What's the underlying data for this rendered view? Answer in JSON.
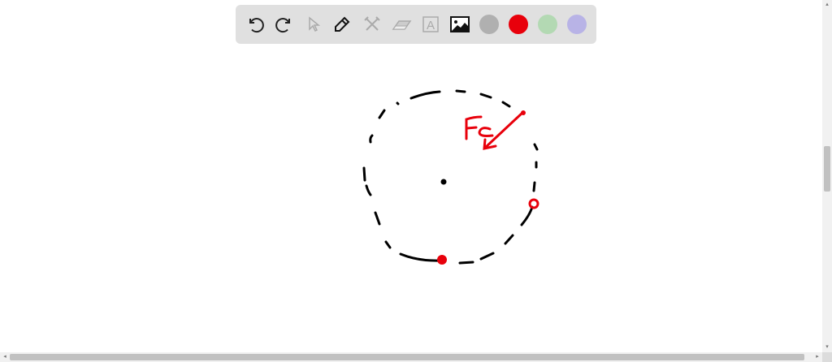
{
  "toolbar": {
    "tools": [
      {
        "name": "undo",
        "icon": "undo-icon",
        "enabled": true
      },
      {
        "name": "redo",
        "icon": "redo-icon",
        "enabled": true
      },
      {
        "name": "select",
        "icon": "cursor-icon",
        "enabled": false
      },
      {
        "name": "pen",
        "icon": "pencil-icon",
        "enabled": true
      },
      {
        "name": "tools",
        "icon": "hammer-wrench-icon",
        "enabled": false
      },
      {
        "name": "eraser",
        "icon": "eraser-icon",
        "enabled": false
      },
      {
        "name": "text",
        "icon": "text-box-icon",
        "enabled": false
      },
      {
        "name": "image",
        "icon": "image-icon",
        "enabled": true
      }
    ],
    "text_tool_glyph": "A",
    "colors": [
      "#b0b0b0",
      "#e8000b",
      "#b3d9b3",
      "#b8b3e6"
    ],
    "selected_color": "#e8000b"
  },
  "drawing": {
    "label": "Fc",
    "ink_black": "#000000",
    "ink_red": "#e8000b"
  },
  "scroll": {
    "horizontal_arrows": [
      "◂",
      "▸"
    ],
    "vertical_arrows": [
      "▴",
      "▾"
    ]
  }
}
